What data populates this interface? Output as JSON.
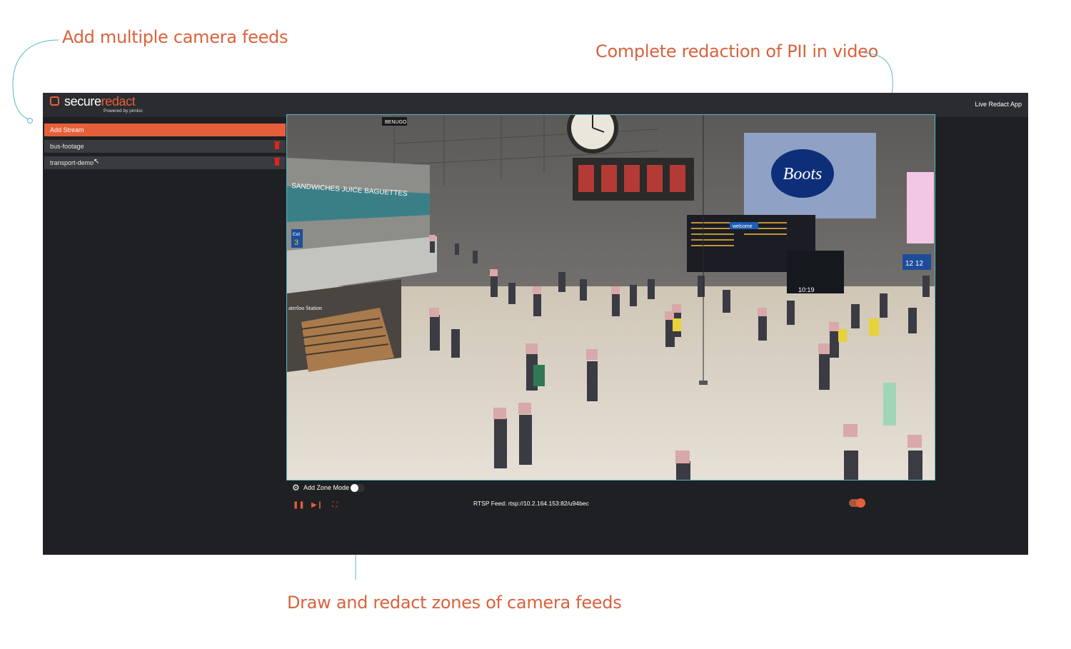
{
  "callouts": {
    "feeds": "Add multiple camera feeds",
    "pii": "Complete redaction of PII in video",
    "zones": "Draw and redact zones of camera feeds"
  },
  "app": {
    "logo_primary": "secure",
    "logo_accent": "redact",
    "logo_sub": "Powered by pimloc",
    "title": "Live Redact App"
  },
  "sidebar": {
    "add_stream": "Add Stream",
    "streams": [
      {
        "label": "bus-footage"
      },
      {
        "label": "transport-demo"
      }
    ]
  },
  "video": {
    "signs": {
      "sandwiches": "SANDWICHES JUICE BAGUETTES",
      "benugo": "BENUGO",
      "boots": "Boots",
      "exit": "Exit",
      "exit_num": "3",
      "station": "aterloo Station",
      "platform": "12 12",
      "welcome": "welcome",
      "clock": "10:19"
    }
  },
  "controls": {
    "zone_mode_label": "Add Zone Mode",
    "zone_mode_on": false,
    "rtsp_label": "RTSP Feed: rtsp://10.2.164.153:82/u94bec",
    "redaction_on": true,
    "pause_icon": "❚❚",
    "step_icon": "▶❙",
    "fullscreen_icon": "⛶"
  },
  "colors": {
    "accent": "#e5603a",
    "callout": "#d9623d",
    "leader": "#57b9c9",
    "app_bg": "#1f2023",
    "delete": "#e0231b"
  }
}
